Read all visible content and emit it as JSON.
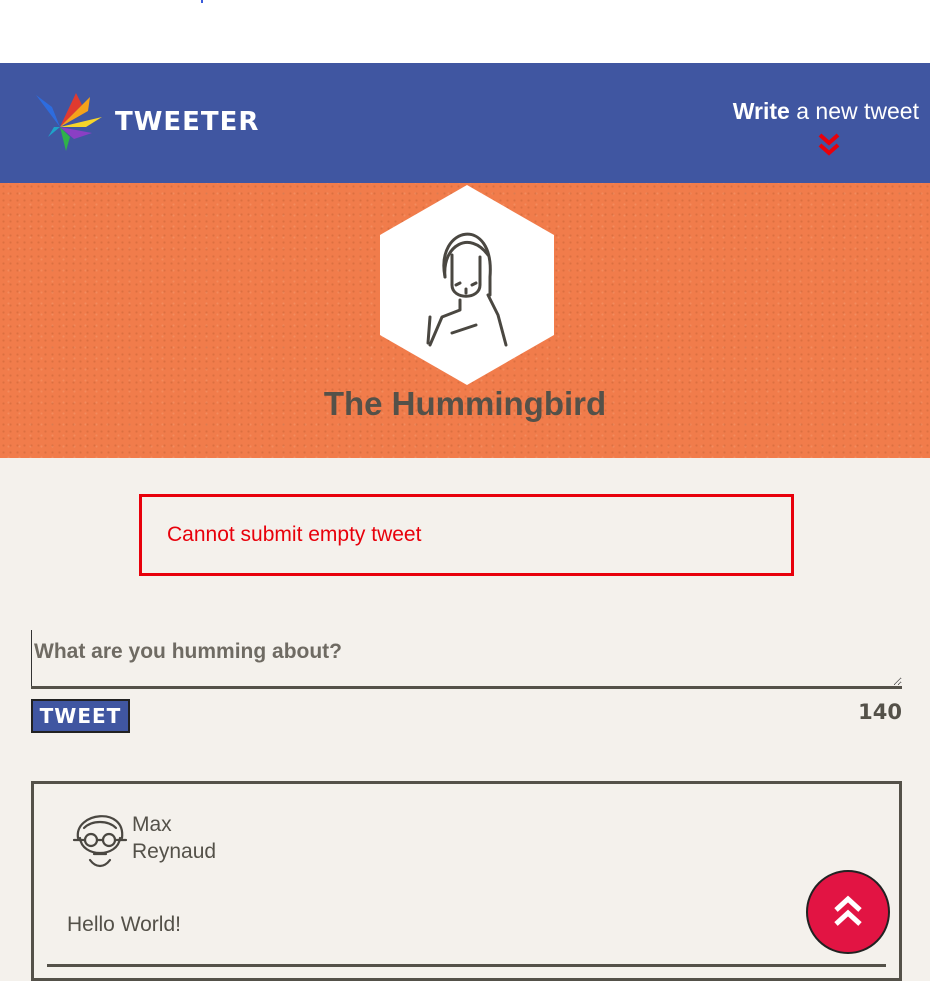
{
  "header": {
    "brand": "TWEETER",
    "write_bold": "Write",
    "write_rest": " a new tweet"
  },
  "profile": {
    "name": "The Hummingbird"
  },
  "error": {
    "message": "Cannot submit empty tweet"
  },
  "compose": {
    "placeholder": "What are you humming about?",
    "value": "",
    "submit_label": "TWEET",
    "counter": "140"
  },
  "tweets": [
    {
      "author_first": "Max",
      "author_last": "Reynaud",
      "content": "Hello World!"
    }
  ],
  "colors": {
    "nav": "#4056a1",
    "hero": "#f17c4b",
    "error": "#e8000b",
    "scroll_button": "#e21443",
    "text": "#545149"
  },
  "icons": {
    "logo": "hummingbird-logo-icon",
    "write_arrow": "double-chevron-down-icon",
    "scroll_top": "double-chevron-up-icon"
  }
}
